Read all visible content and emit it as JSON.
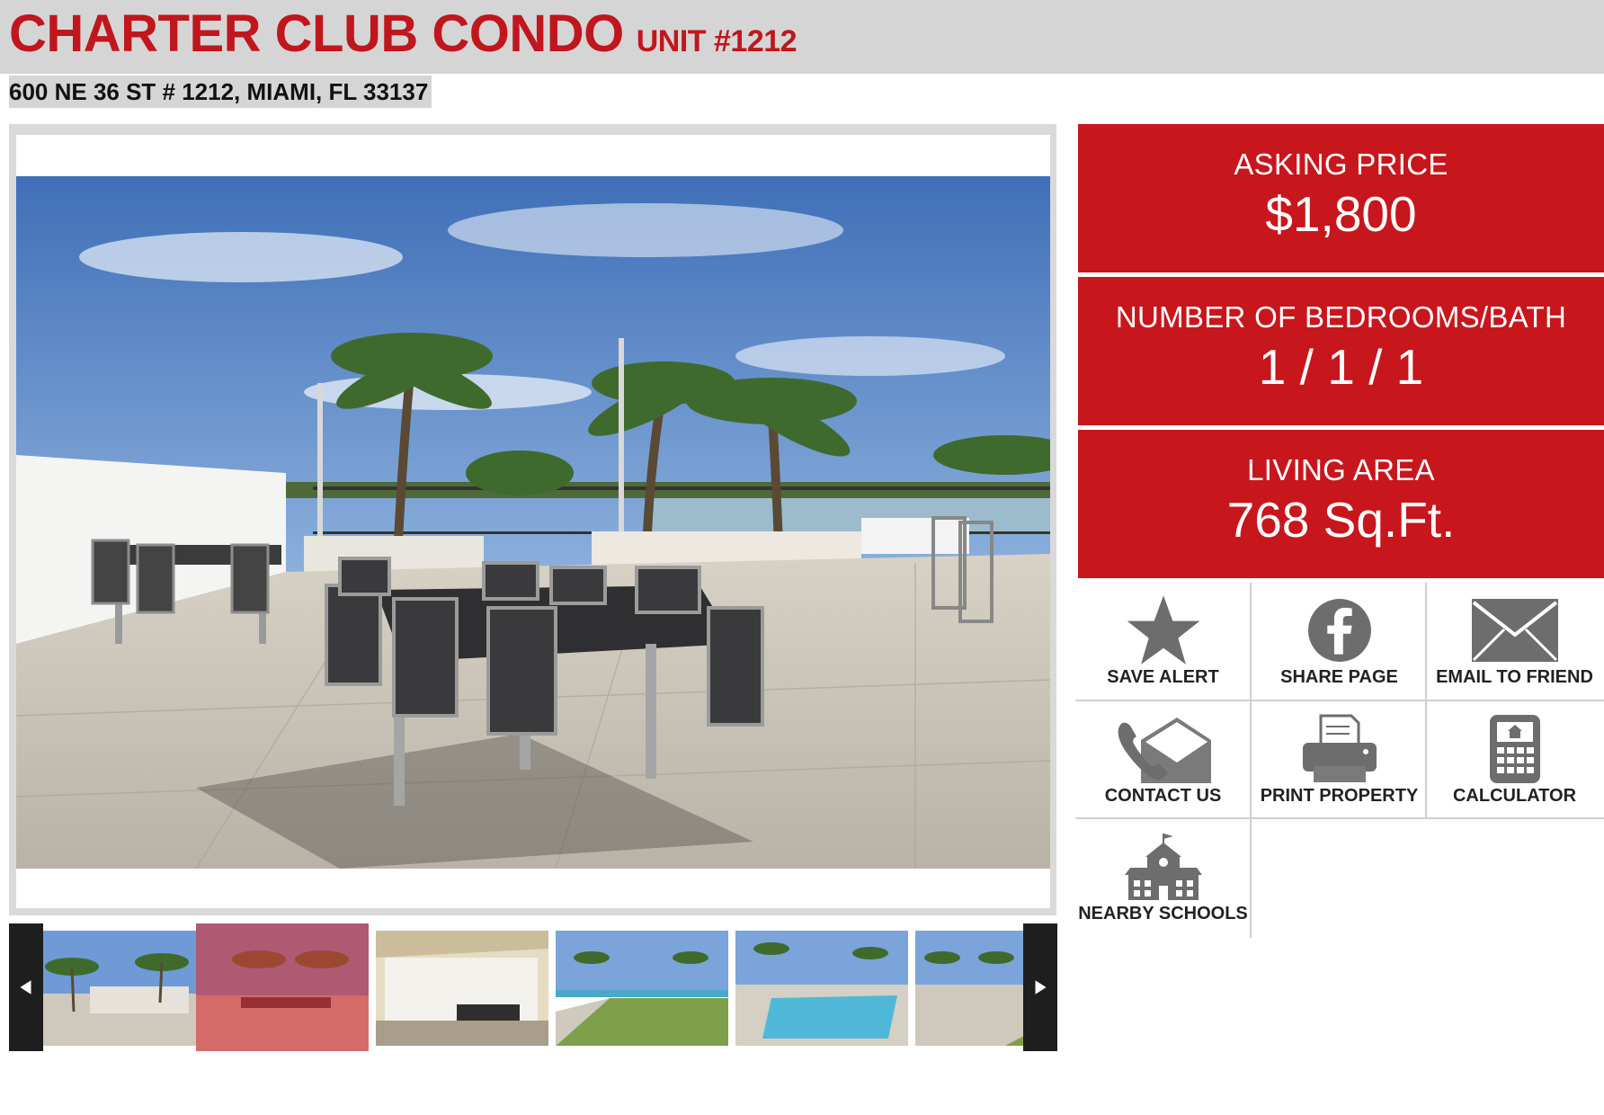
{
  "header": {
    "title": "CHARTER CLUB CONDO",
    "unit": "UNIT #1212",
    "address": "600 NE 36 ST # 1212, MIAMI, FL 33137"
  },
  "gallery": {
    "thumbnail_count": 6,
    "active_index": 1,
    "prev_icon": "triangle-left-icon",
    "next_icon": "triangle-right-icon"
  },
  "details": [
    {
      "label": "ASKING PRICE",
      "value": "$1,800"
    },
    {
      "label": "NUMBER OF BEDROOMS/BATH",
      "value": "1 / 1 / 1"
    },
    {
      "label": "LIVING AREA",
      "value": "768 Sq.Ft."
    }
  ],
  "actions": [
    {
      "label": "SAVE ALERT",
      "icon": "star-icon"
    },
    {
      "label": "SHARE PAGE",
      "icon": "facebook-icon"
    },
    {
      "label": "EMAIL TO FRIEND",
      "icon": "envelope-icon"
    },
    {
      "label": "CONTACT US",
      "icon": "phone-envelope-icon"
    },
    {
      "label": "PRINT PROPERTY",
      "icon": "printer-icon"
    },
    {
      "label": "CALCULATOR",
      "icon": "calculator-icon"
    },
    {
      "label": "NEARBY SCHOOLS",
      "icon": "school-icon"
    }
  ],
  "colors": {
    "brand_red": "#c8161d",
    "header_gray": "#d5d5d5",
    "icon_gray": "#6d6d6d"
  }
}
